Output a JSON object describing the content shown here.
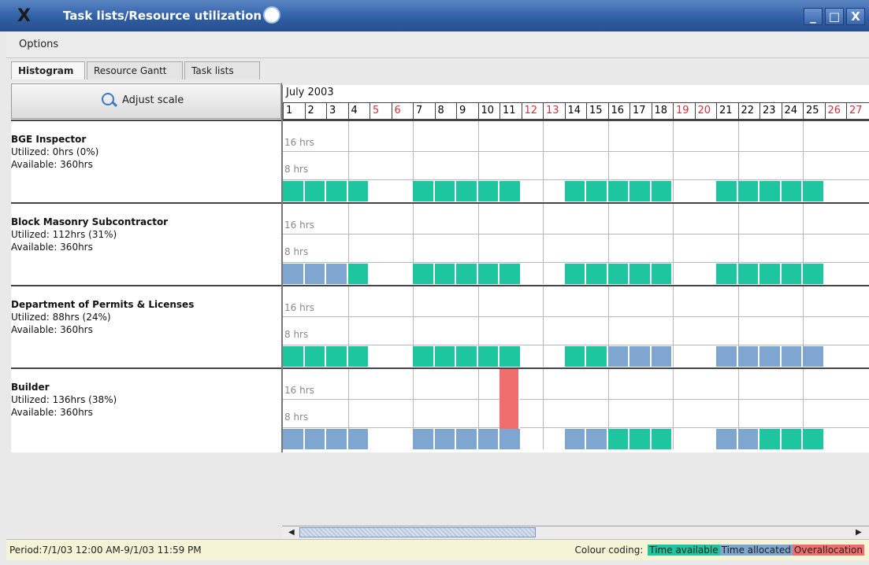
{
  "window": {
    "title": "Task lists/Resource utilization",
    "min": "_",
    "max": "□",
    "close": "X",
    "x_glyph": "X"
  },
  "menu": {
    "options": "Options"
  },
  "tabs": [
    "Histogram",
    "Resource Gantt",
    "Task lists"
  ],
  "adjust_scale": "Adjust scale",
  "timeline": {
    "month": "July 2003",
    "days": [
      {
        "label": "1",
        "weekend": false
      },
      {
        "label": "2",
        "weekend": false
      },
      {
        "label": "3",
        "weekend": false
      },
      {
        "label": "4",
        "weekend": false
      },
      {
        "label": "5",
        "weekend": true
      },
      {
        "label": "6",
        "weekend": true
      },
      {
        "label": "7",
        "weekend": false
      },
      {
        "label": "8",
        "weekend": false
      },
      {
        "label": "9",
        "weekend": false
      },
      {
        "label": "10",
        "weekend": false
      },
      {
        "label": "11",
        "weekend": false
      },
      {
        "label": "12",
        "weekend": true
      },
      {
        "label": "13",
        "weekend": true
      },
      {
        "label": "14",
        "weekend": false
      },
      {
        "label": "15",
        "weekend": false
      },
      {
        "label": "16",
        "weekend": false
      },
      {
        "label": "17",
        "weekend": false
      },
      {
        "label": "18",
        "weekend": false
      },
      {
        "label": "19",
        "weekend": true
      },
      {
        "label": "20",
        "weekend": true
      },
      {
        "label": "21",
        "weekend": false
      },
      {
        "label": "22",
        "weekend": false
      },
      {
        "label": "23",
        "weekend": false
      },
      {
        "label": "24",
        "weekend": false
      },
      {
        "label": "25",
        "weekend": false
      },
      {
        "label": "26",
        "weekend": true
      },
      {
        "label": "27",
        "weekend": true
      }
    ]
  },
  "scale_labels": {
    "high": "16 hrs",
    "low": "8 hrs"
  },
  "resources": [
    {
      "name": "BGE Inspector",
      "utilized": "Utilized: 0hrs (0%)",
      "available": "Available: 360hrs",
      "days": [
        "a",
        "a",
        "a",
        "a",
        "",
        "",
        "a",
        "a",
        "a",
        "a",
        "a",
        "",
        "",
        "a",
        "a",
        "a",
        "a",
        "a",
        "",
        "",
        "a",
        "a",
        "a",
        "a",
        "a",
        "",
        ""
      ]
    },
    {
      "name": "Block Masonry Subcontractor",
      "utilized": "Utilized: 112hrs (31%)",
      "available": "Available: 360hrs",
      "days": [
        "t",
        "t",
        "t",
        "a",
        "",
        "",
        "a",
        "a",
        "a",
        "a",
        "a",
        "",
        "",
        "a",
        "a",
        "a",
        "a",
        "a",
        "",
        "",
        "a",
        "a",
        "a",
        "a",
        "a",
        "",
        ""
      ]
    },
    {
      "name": "Department of Permits & Licenses",
      "utilized": "Utilized: 88hrs (24%)",
      "available": "Available: 360hrs",
      "days": [
        "a",
        "a",
        "a",
        "a",
        "",
        "",
        "a",
        "a",
        "a",
        "a",
        "a",
        "",
        "",
        "a",
        "a",
        "t",
        "t",
        "t",
        "",
        "",
        "t",
        "t",
        "t",
        "t",
        "t",
        "",
        ""
      ]
    },
    {
      "name": "Builder",
      "utilized": "Utilized: 136hrs (38%)",
      "available": "Available: 360hrs",
      "days": [
        "t",
        "t",
        "t",
        "t",
        "",
        "",
        "t",
        "t",
        "t",
        "t",
        "t",
        "",
        "",
        "t",
        "t",
        "a",
        "a",
        "a",
        "",
        "",
        "t",
        "t",
        "a",
        "a",
        "a",
        "",
        ""
      ],
      "overallocation": {
        "day": "11",
        "hours": 24
      }
    }
  ],
  "colors": {
    "available": "#1ec6a0",
    "allocated": "#7ea6d0",
    "over": "#f06e6e"
  },
  "status": {
    "period": "Period:7/1/03 12:00 AM-9/1/03 11:59 PM",
    "legend_label": "Colour coding:",
    "legend_available": "Time available",
    "legend_allocated": "Time allocated",
    "legend_over": "Overallocation"
  }
}
